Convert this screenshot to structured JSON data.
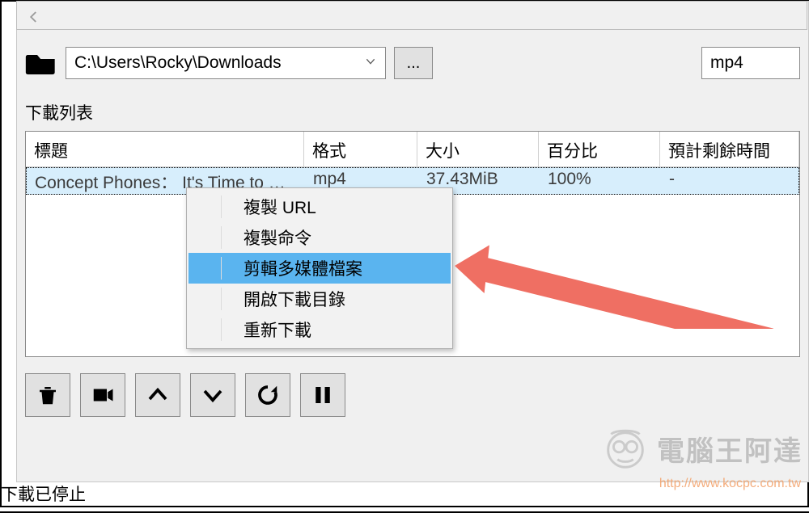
{
  "path": {
    "value": "C:\\Users\\Rocky\\Downloads",
    "browse_label": "..."
  },
  "format": {
    "value": "mp4"
  },
  "list": {
    "label": "下載列表"
  },
  "columns": {
    "title": "標題",
    "format": "格式",
    "size": "大小",
    "percent": "百分比",
    "eta": "預計剩餘時間"
  },
  "rows": [
    {
      "title": "Concept Phones： It's Time to …",
      "format": "mp4",
      "size": "37.43MiB",
      "percent": "100%",
      "eta": "-"
    }
  ],
  "context_menu": {
    "items": [
      {
        "label": "複製 URL"
      },
      {
        "label": "複製命令"
      },
      {
        "label": "剪輯多媒體檔案",
        "highlight": true
      },
      {
        "label": "開啟下載目錄"
      },
      {
        "label": "重新下載"
      }
    ]
  },
  "status": "下載已停止",
  "watermark": {
    "text": "電腦王阿達",
    "url": "http://www.kocpc.com.tw"
  }
}
